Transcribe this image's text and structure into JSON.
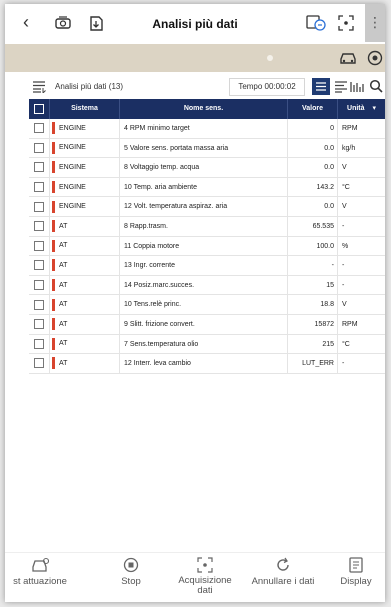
{
  "header": {
    "title": "Analisi più dati",
    "back_icon": "chevron-left-icon",
    "more_icon": "more-vertical-icon"
  },
  "toolbar": {
    "list_label": "Analisi più dati (13)",
    "time_label": "Tempo 00:00:02"
  },
  "table": {
    "headers": [
      "Sistema",
      "Nome sens.",
      "Valore",
      "Unità"
    ],
    "rows": [
      {
        "system": "ENGINE",
        "name": "4 RPM minimo target",
        "value": "0",
        "unit": "RPM"
      },
      {
        "system": "ENGINE",
        "name": "5 Valore sens. portata massa aria",
        "value": "0.0",
        "unit": "kg/h"
      },
      {
        "system": "ENGINE",
        "name": "8 Voltaggio temp. acqua",
        "value": "0.0",
        "unit": "V"
      },
      {
        "system": "ENGINE",
        "name": "10 Temp. aria ambiente",
        "value": "143.2",
        "unit": "°C"
      },
      {
        "system": "ENGINE",
        "name": "12 Volt. temperatura aspiraz. aria",
        "value": "0.0",
        "unit": "V"
      },
      {
        "system": "AT",
        "name": "8 Rapp.trasm.",
        "value": "65.535",
        "unit": "-"
      },
      {
        "system": "AT",
        "name": "11 Coppia motore",
        "value": "100.0",
        "unit": "%"
      },
      {
        "system": "AT",
        "name": "13 Ingr. corrente",
        "value": "-",
        "unit": "-"
      },
      {
        "system": "AT",
        "name": "14 Posiz.marc.succes.",
        "value": "15",
        "unit": "-"
      },
      {
        "system": "AT",
        "name": "10 Tens.relè princ.",
        "value": "18.8",
        "unit": "V"
      },
      {
        "system": "AT",
        "name": "9 Slitt. frizione convert.",
        "value": "15872",
        "unit": "RPM"
      },
      {
        "system": "AT",
        "name": "7 Sens.temperatura olio",
        "value": "215",
        "unit": "°C"
      },
      {
        "system": "AT",
        "name": "12 Interr. leva cambio",
        "value": "LUT_ERR",
        "unit": "-"
      }
    ]
  },
  "bottom_nav": [
    {
      "label": "st attuazione",
      "icon": "car-actuation-icon"
    },
    {
      "label": "Stop",
      "icon": "stop-icon"
    },
    {
      "label": "Acquisizione dati",
      "icon": "capture-icon"
    },
    {
      "label": "Annullare i dati",
      "icon": "refresh-icon"
    },
    {
      "label": "Display",
      "icon": "display-icon"
    }
  ],
  "colors": {
    "accent": "#1b2f63",
    "status_bar": "#dcd4c4",
    "flag": "#d8442e"
  }
}
